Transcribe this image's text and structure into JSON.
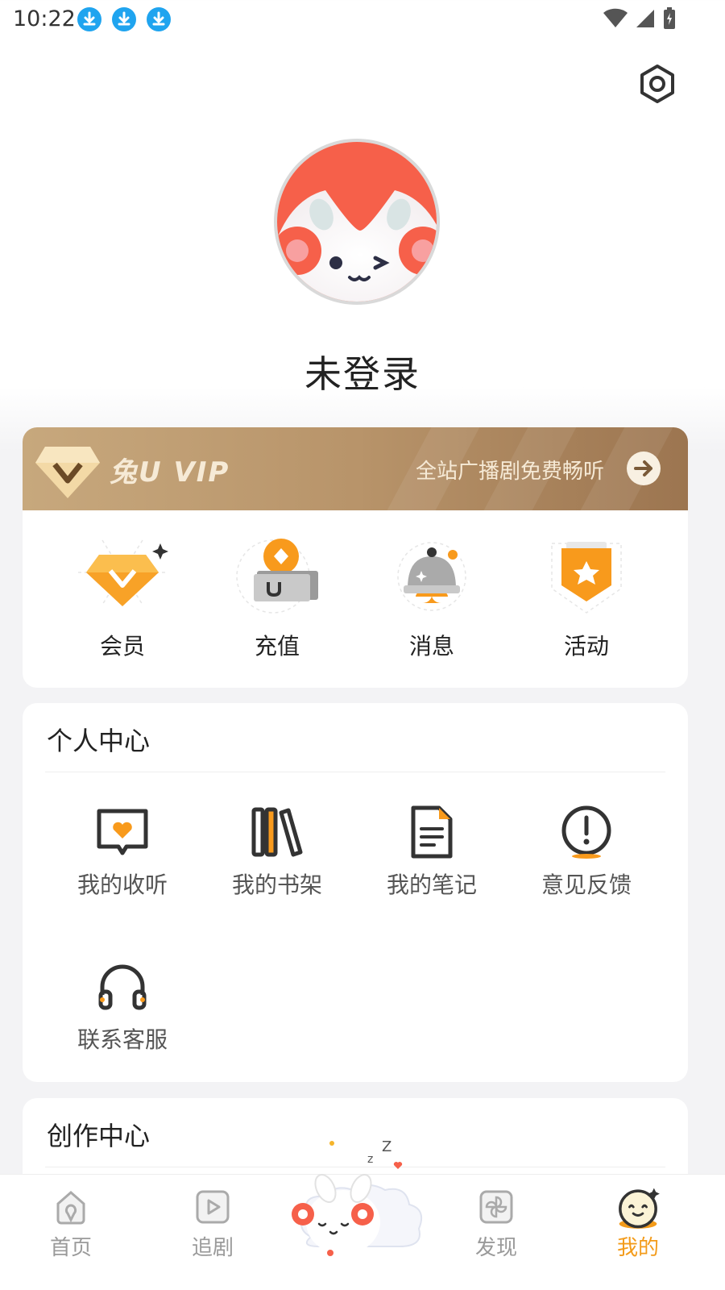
{
  "status_bar": {
    "time": "10:22"
  },
  "profile": {
    "title": "未登录"
  },
  "vip": {
    "logo_text": "兔U VIP",
    "slogan": "全站广播剧免费畅听"
  },
  "quick_actions": [
    {
      "label": "会员",
      "icon": "diamond-icon"
    },
    {
      "label": "充值",
      "icon": "coin-wallet-icon"
    },
    {
      "label": "消息",
      "icon": "bell-icon"
    },
    {
      "label": "活动",
      "icon": "star-badge-icon"
    }
  ],
  "personal_center": {
    "title": "个人中心",
    "items": [
      {
        "label": "我的收听",
        "icon": "heart-chat-icon"
      },
      {
        "label": "我的书架",
        "icon": "bookshelf-icon"
      },
      {
        "label": "我的笔记",
        "icon": "note-icon"
      },
      {
        "label": "意见反馈",
        "icon": "exclamation-icon"
      },
      {
        "label": "联系客服",
        "icon": "headphones-icon"
      }
    ]
  },
  "creation_center": {
    "title": "创作中心"
  },
  "tabbar": {
    "tabs": [
      {
        "label": "首页",
        "icon": "home-icon"
      },
      {
        "label": "追剧",
        "icon": "play-icon"
      },
      {
        "label": "发现",
        "icon": "pinwheel-icon"
      },
      {
        "label": "我的",
        "icon": "smiley-icon",
        "active": true
      }
    ]
  },
  "colors": {
    "accent": "#f39b1a",
    "vip_gold": "#b8946a",
    "download_blue": "#1fa4ef"
  }
}
